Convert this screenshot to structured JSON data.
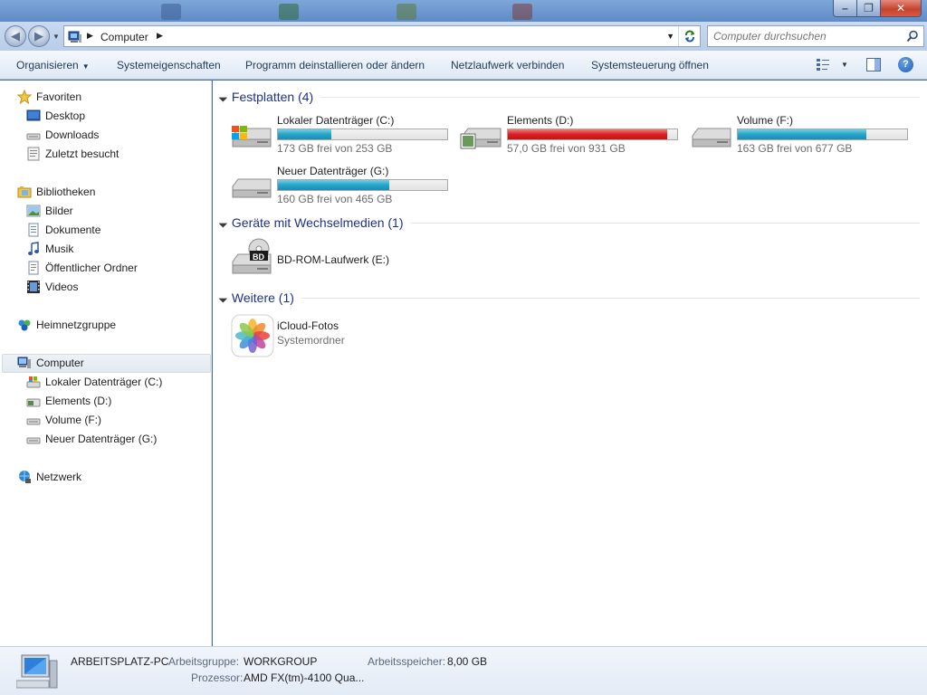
{
  "window": {
    "controls": {
      "minimize": "–",
      "maximize": "❐",
      "close": "✕"
    }
  },
  "address": {
    "crumb": "Computer",
    "search_placeholder": "Computer durchsuchen"
  },
  "toolbar": {
    "organize": "Organisieren",
    "system_properties": "Systemeigenschaften",
    "uninstall": "Programm deinstallieren oder ändern",
    "map_drive": "Netzlaufwerk verbinden",
    "control_panel": "Systemsteuerung öffnen"
  },
  "nav": {
    "favorites": "Favoriten",
    "desktop": "Desktop",
    "downloads": "Downloads",
    "recent": "Zuletzt besucht",
    "libraries": "Bibliotheken",
    "pictures": "Bilder",
    "documents": "Dokumente",
    "music": "Musik",
    "public": "Öffentlicher Ordner",
    "videos": "Videos",
    "homegroup": "Heimnetzgruppe",
    "computer": "Computer",
    "drive_c": "Lokaler Datenträger (C:)",
    "drive_d": "Elements (D:)",
    "drive_f": "Volume (F:)",
    "drive_g": "Neuer Datenträger (G:)",
    "network": "Netzwerk"
  },
  "groups": {
    "hard_drives": "Festplatten (4)",
    "removable": "Geräte mit Wechselmedien (1)",
    "other": "Weitere (1)"
  },
  "drives": [
    {
      "name": "Lokaler Datenträger (C:)",
      "size": "173 GB frei von 253 GB",
      "used_fraction": 0.316,
      "color": "#27a3c8"
    },
    {
      "name": "Elements (D:)",
      "size": "57,0 GB frei von 931 GB",
      "used_fraction": 0.939,
      "color": "#da2020"
    },
    {
      "name": "Volume (F:)",
      "size": "163 GB frei von 677 GB",
      "used_fraction": 0.759,
      "color": "#27a3c8"
    },
    {
      "name": "Neuer Datenträger (G:)",
      "size": "160 GB frei von 465 GB",
      "used_fraction": 0.656,
      "color": "#27a3c8"
    }
  ],
  "removable": {
    "name": "BD-ROM-Laufwerk (E:)",
    "badge": "BD"
  },
  "other_items": {
    "name": "iCloud-Fotos",
    "type": "Systemordner"
  },
  "details": {
    "pc_name": "ARBEITSPLATZ-PC",
    "workgroup_label": "Arbeitsgruppe:",
    "workgroup": "WORKGROUP",
    "memory_label": "Arbeitsspeicher:",
    "memory": "8,00 GB",
    "cpu_label": "Prozessor:",
    "cpu": "AMD FX(tm)-4100 Qua..."
  }
}
